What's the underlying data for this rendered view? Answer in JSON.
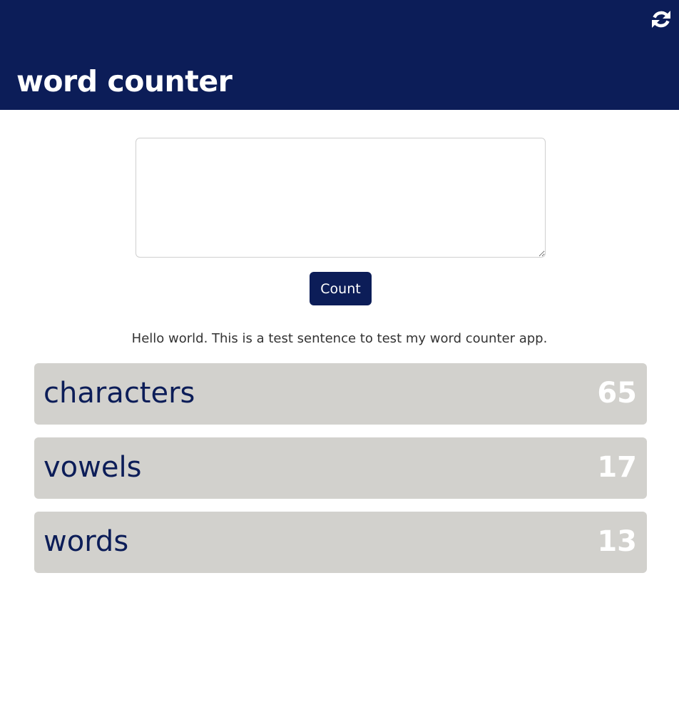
{
  "header": {
    "title": "word counter",
    "refresh_icon": "refresh-icon"
  },
  "input": {
    "value": "",
    "placeholder": ""
  },
  "count_button": {
    "label": "Count"
  },
  "result": {
    "text": "Hello world. This is a test sentence to test my word counter app."
  },
  "stats": [
    {
      "label": "characters",
      "value": "65"
    },
    {
      "label": "vowels",
      "value": "17"
    },
    {
      "label": "words",
      "value": "13"
    }
  ],
  "colors": {
    "primary": "#0c1d58",
    "card_background": "#d2d1cd",
    "value_text": "#ffffff"
  }
}
